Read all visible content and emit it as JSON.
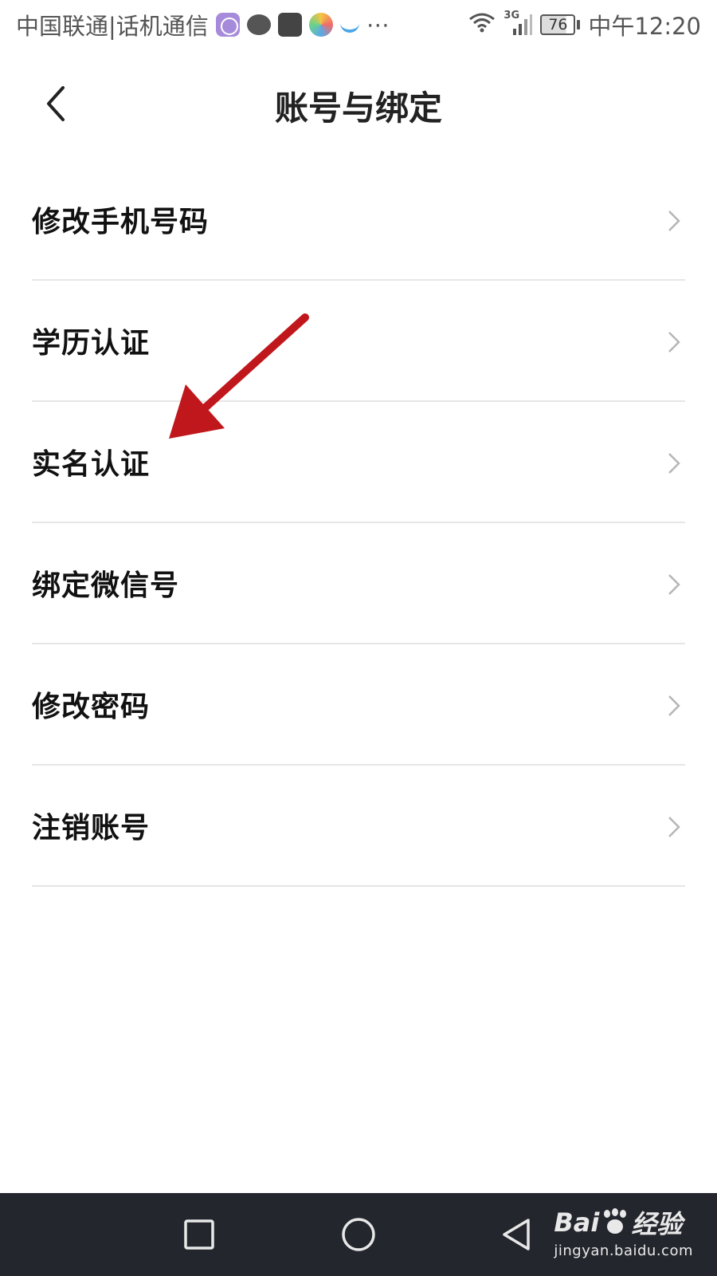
{
  "status_bar": {
    "carrier": "中国联通|话机通信",
    "notification_icons": [
      "browser-icon",
      "chat-bubble-icon",
      "huawei-appgallery-icon",
      "colorful-ball-icon",
      "swirl-icon"
    ],
    "overflow": "⋯",
    "network_type": "3G",
    "battery_level": "76",
    "time": "中午12:20"
  },
  "header": {
    "title": "账号与绑定"
  },
  "menu": {
    "items": [
      {
        "label": "修改手机号码"
      },
      {
        "label": "学历认证"
      },
      {
        "label": "实名认证"
      },
      {
        "label": "绑定微信号"
      },
      {
        "label": "修改密码"
      },
      {
        "label": "注销账号"
      }
    ]
  },
  "annotation": {
    "color": "#c0171c",
    "target": "实名认证"
  },
  "nav_bar": {
    "background": "#23262d"
  },
  "watermark": {
    "brand": "Bai",
    "brand_suffix": "经验",
    "url": "jingyan.baidu.com"
  }
}
